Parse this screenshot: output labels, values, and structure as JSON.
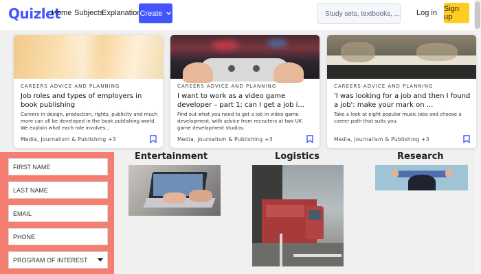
{
  "nav": {
    "logo": "Quizlet",
    "links": [
      "Home",
      "Subjects",
      "Explanations"
    ],
    "create_label": "Create",
    "search_placeholder": "Study sets, textbooks, ...",
    "login_label": "Log in",
    "signup_label": "Sign up"
  },
  "colors": {
    "brand": "#4255ff",
    "signup": "#ffcd1f",
    "form_panel": "#f47e72",
    "bookmark": "#4255ff"
  },
  "cards": [
    {
      "category": "CAREERS ADVICE AND PLANNING",
      "title": "Job roles and types of employers in book publishing",
      "desc": "Careers in design, production, rights, publicity and much more can all be developed in the book publishing world. We explain what each role involves...",
      "tags": "Media, Journalism & Publishing +3"
    },
    {
      "category": "CAREERS ADVICE AND PLANNING",
      "title": "I want to work as a video game developer – part 1: can I get a job i...",
      "desc": "Find out what you need to get a job in video game development, with advice from recruiters at two UK game development studios.",
      "tags": "Media, Journalism & Publishing +3"
    },
    {
      "category": "CAREERS ADVICE AND PLANNING",
      "title": "'I was looking for a job and then I found a job': make your mark on ...",
      "desc": "Take a look at eight popular music jobs and choose a career path that suits you.",
      "tags": "Media, Journalism & Publishing +3"
    }
  ],
  "form": {
    "first_name": "FIRST NAME",
    "last_name": "LAST NAME",
    "email": "EMAIL",
    "phone": "PHONE",
    "program": "PROGRAM OF INTEREST"
  },
  "industries": [
    "Entertainment",
    "Logistics",
    "Research"
  ]
}
